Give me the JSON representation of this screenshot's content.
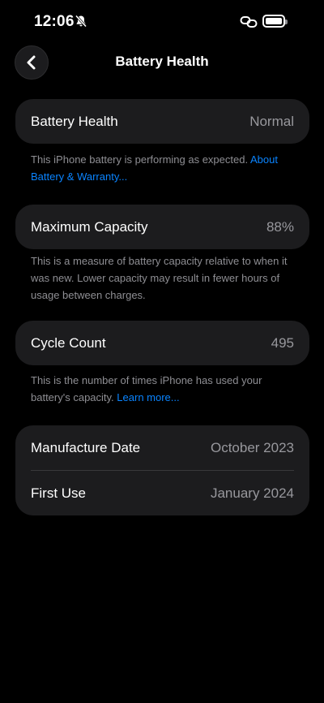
{
  "status_bar": {
    "time": "12:06",
    "icons": [
      "bell-slash-icon",
      "link-icon",
      "battery-icon"
    ]
  },
  "nav": {
    "title": "Battery Health",
    "back_icon": "chevron-left-icon"
  },
  "battery_health": {
    "label": "Battery Health",
    "value": "Normal",
    "footer_text": "This iPhone battery is performing as expected. ",
    "footer_link": "About Battery & Warranty..."
  },
  "maximum_capacity": {
    "label": "Maximum Capacity",
    "value": "88%",
    "footer_text": "This is a measure of battery capacity relative to when it was new. Lower capacity may result in fewer hours of usage between charges."
  },
  "cycle_count": {
    "label": "Cycle Count",
    "value": "495",
    "footer_text": "This is the number of times iPhone has used your battery's capacity. ",
    "footer_link": "Learn more..."
  },
  "dates": {
    "manufacture_label": "Manufacture Date",
    "manufacture_value": "October 2023",
    "first_use_label": "First Use",
    "first_use_value": "January 2024"
  },
  "colors": {
    "background": "#000000",
    "card": "#1c1c1e",
    "link": "#0a84ff",
    "secondary_text": "#8e8e93"
  }
}
